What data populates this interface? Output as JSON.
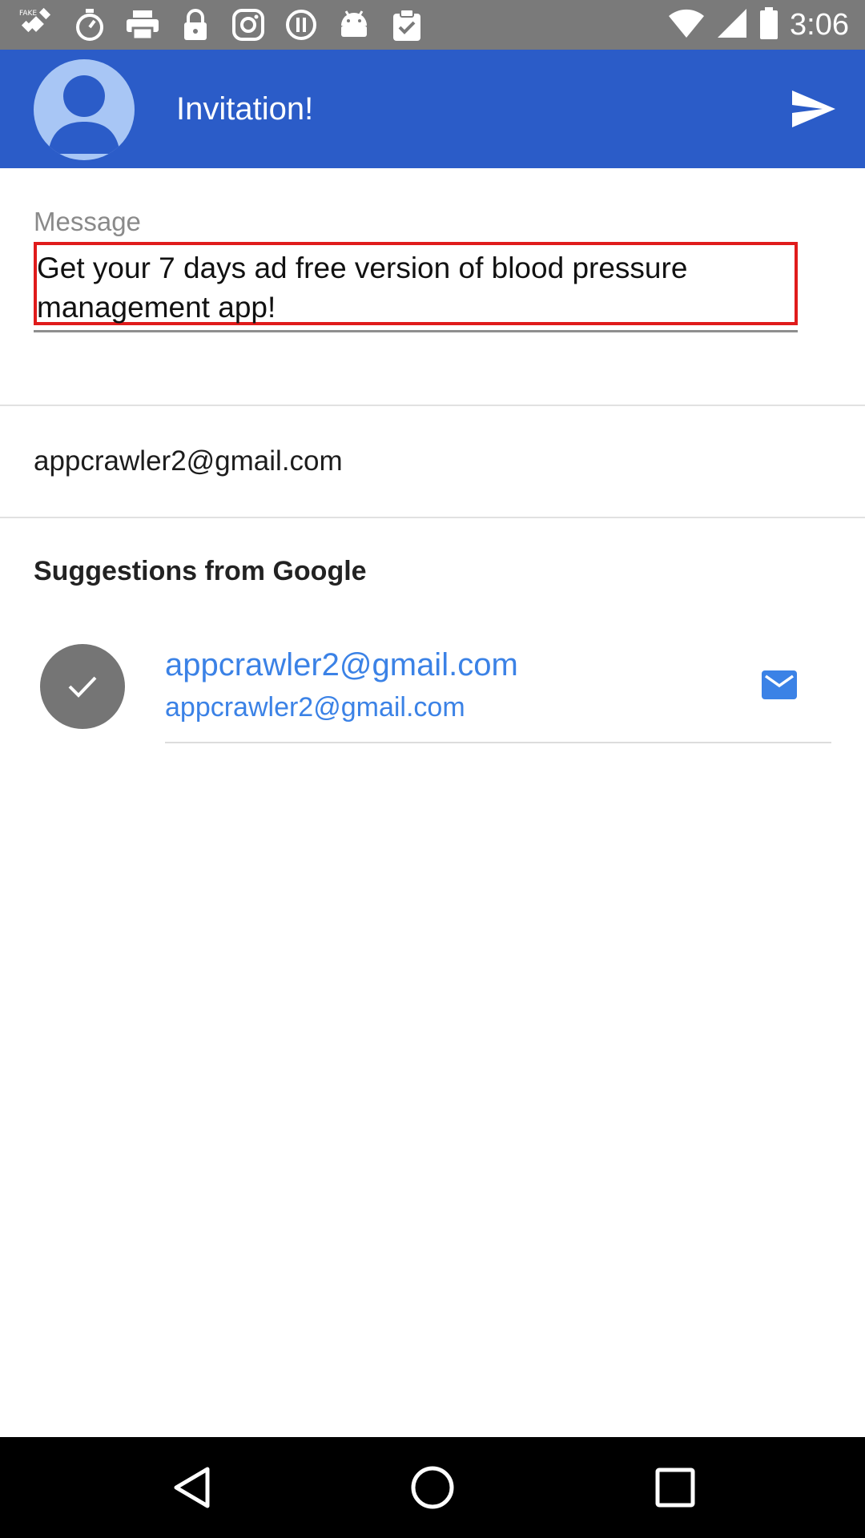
{
  "status_bar": {
    "time": "3:06",
    "icons": [
      "fake-gps-icon",
      "stopwatch-icon",
      "printer-icon",
      "lock-icon",
      "instagram-icon",
      "info-icon",
      "android-icon",
      "clipboard-check-icon",
      "wifi-icon",
      "signal-icon",
      "battery-icon"
    ]
  },
  "app_bar": {
    "title": "Invitation!",
    "color": "#2b5cc8"
  },
  "message": {
    "label": "Message",
    "value": "Get your 7 days ad free version of blood pressure management app!"
  },
  "recipient": {
    "email": "appcrawler2@gmail.com"
  },
  "suggestions": {
    "title": "Suggestions from Google",
    "items": [
      {
        "name": "appcrawler2@gmail.com",
        "email": "appcrawler2@gmail.com",
        "selected": true
      }
    ]
  },
  "colors": {
    "accent": "#3b82e6",
    "highlight_border": "#e01b1b"
  }
}
